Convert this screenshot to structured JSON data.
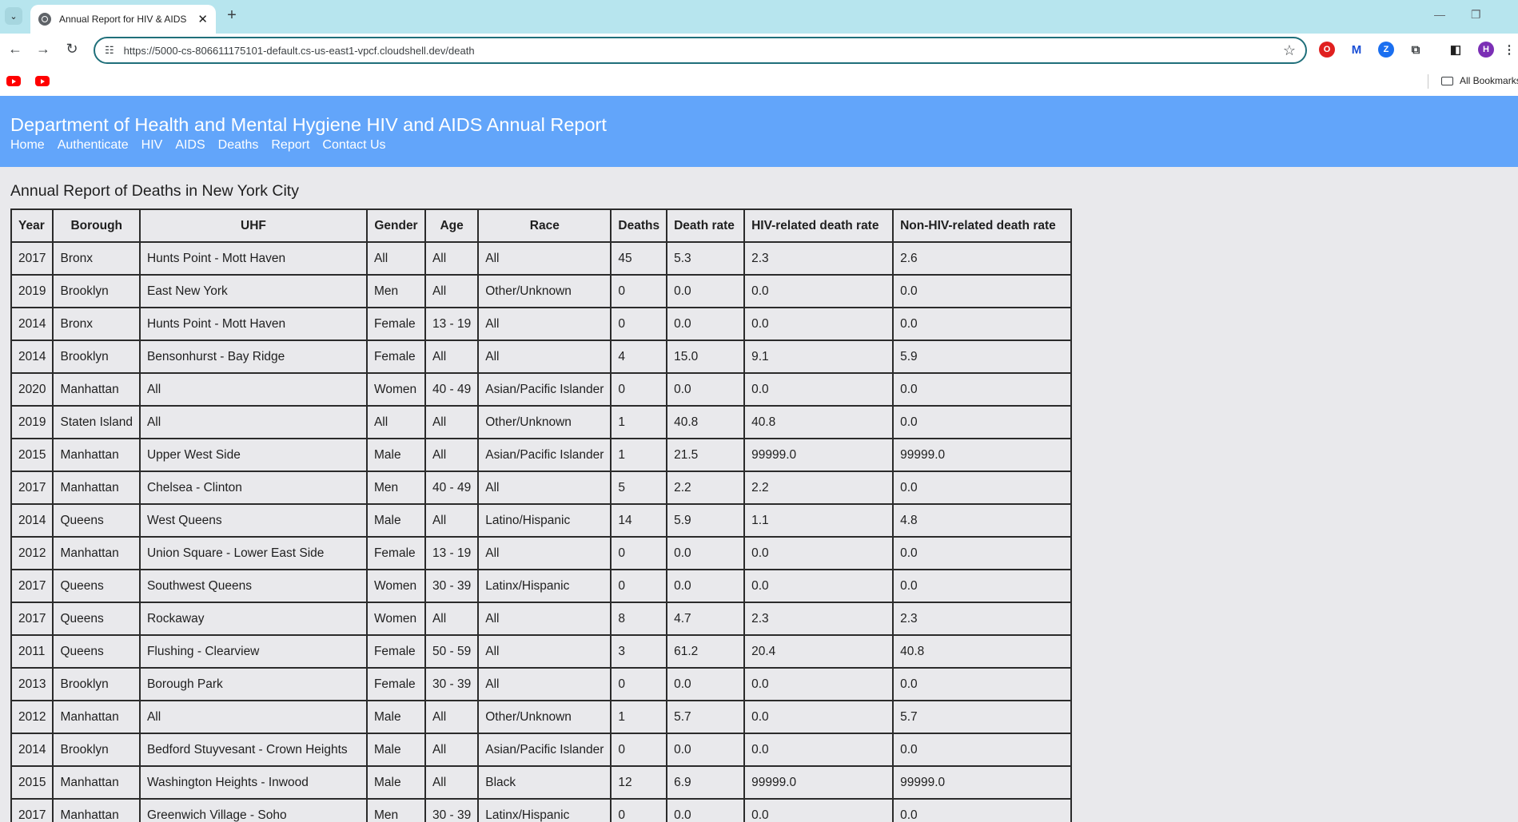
{
  "browser": {
    "tab_title": "Annual Report for HIV & AIDS",
    "url": "https://5000-cs-806611175101-default.cs-us-east1-vpcf.cloudshell.dev/death",
    "all_bookmarks_label": "All Bookmarks",
    "profile_initial": "H",
    "extensions": [
      "opera-icon",
      "m-icon",
      "z-icon",
      "puzzle-icon"
    ],
    "colors": {
      "tabstrip": "#b7e5ee",
      "omnibox_border": "#1f6f7a"
    }
  },
  "site": {
    "title": "Department of Health and Mental Hygiene HIV and AIDS Annual Report",
    "nav": [
      "Home",
      "Authenticate",
      "HIV",
      "AIDS",
      "Deaths",
      "Report",
      "Contact Us"
    ],
    "header_color": "#62a5fa"
  },
  "page": {
    "heading": "Annual Report of Deaths in New York City"
  },
  "table": {
    "columns": [
      "Year",
      "Borough",
      "UHF",
      "Gender",
      "Age",
      "Race",
      "Deaths",
      "Death rate",
      "HIV-related death rate",
      "Non-HIV-related death rate"
    ],
    "rows": [
      [
        "2017",
        "Bronx",
        "Hunts Point - Mott Haven",
        "All",
        "All",
        "All",
        "45",
        "5.3",
        "2.3",
        "2.6"
      ],
      [
        "2019",
        "Brooklyn",
        "East New York",
        "Men",
        "All",
        "Other/Unknown",
        "0",
        "0.0",
        "0.0",
        "0.0"
      ],
      [
        "2014",
        "Bronx",
        "Hunts Point - Mott Haven",
        "Female",
        "13 - 19",
        "All",
        "0",
        "0.0",
        "0.0",
        "0.0"
      ],
      [
        "2014",
        "Brooklyn",
        "Bensonhurst - Bay Ridge",
        "Female",
        "All",
        "All",
        "4",
        "15.0",
        "9.1",
        "5.9"
      ],
      [
        "2020",
        "Manhattan",
        "All",
        "Women",
        "40 - 49",
        "Asian/Pacific Islander",
        "0",
        "0.0",
        "0.0",
        "0.0"
      ],
      [
        "2019",
        "Staten Island",
        "All",
        "All",
        "All",
        "Other/Unknown",
        "1",
        "40.8",
        "40.8",
        "0.0"
      ],
      [
        "2015",
        "Manhattan",
        "Upper West Side",
        "Male",
        "All",
        "Asian/Pacific Islander",
        "1",
        "21.5",
        "99999.0",
        "99999.0"
      ],
      [
        "2017",
        "Manhattan",
        "Chelsea - Clinton",
        "Men",
        "40 - 49",
        "All",
        "5",
        "2.2",
        "2.2",
        "0.0"
      ],
      [
        "2014",
        "Queens",
        "West Queens",
        "Male",
        "All",
        "Latino/Hispanic",
        "14",
        "5.9",
        "1.1",
        "4.8"
      ],
      [
        "2012",
        "Manhattan",
        "Union Square - Lower East Side",
        "Female",
        "13 - 19",
        "All",
        "0",
        "0.0",
        "0.0",
        "0.0"
      ],
      [
        "2017",
        "Queens",
        "Southwest Queens",
        "Women",
        "30 - 39",
        "Latinx/Hispanic",
        "0",
        "0.0",
        "0.0",
        "0.0"
      ],
      [
        "2017",
        "Queens",
        "Rockaway",
        "Women",
        "All",
        "All",
        "8",
        "4.7",
        "2.3",
        "2.3"
      ],
      [
        "2011",
        "Queens",
        "Flushing - Clearview",
        "Female",
        "50 - 59",
        "All",
        "3",
        "61.2",
        "20.4",
        "40.8"
      ],
      [
        "2013",
        "Brooklyn",
        "Borough Park",
        "Female",
        "30 - 39",
        "All",
        "0",
        "0.0",
        "0.0",
        "0.0"
      ],
      [
        "2012",
        "Manhattan",
        "All",
        "Male",
        "All",
        "Other/Unknown",
        "1",
        "5.7",
        "0.0",
        "5.7"
      ],
      [
        "2014",
        "Brooklyn",
        "Bedford Stuyvesant - Crown Heights",
        "Male",
        "All",
        "Asian/Pacific Islander",
        "0",
        "0.0",
        "0.0",
        "0.0"
      ],
      [
        "2015",
        "Manhattan",
        "Washington Heights - Inwood",
        "Male",
        "All",
        "Black",
        "12",
        "6.9",
        "99999.0",
        "99999.0"
      ],
      [
        "2017",
        "Manhattan",
        "Greenwich Village - Soho",
        "Men",
        "30 - 39",
        "Latinx/Hispanic",
        "0",
        "0.0",
        "0.0",
        "0.0"
      ]
    ]
  }
}
